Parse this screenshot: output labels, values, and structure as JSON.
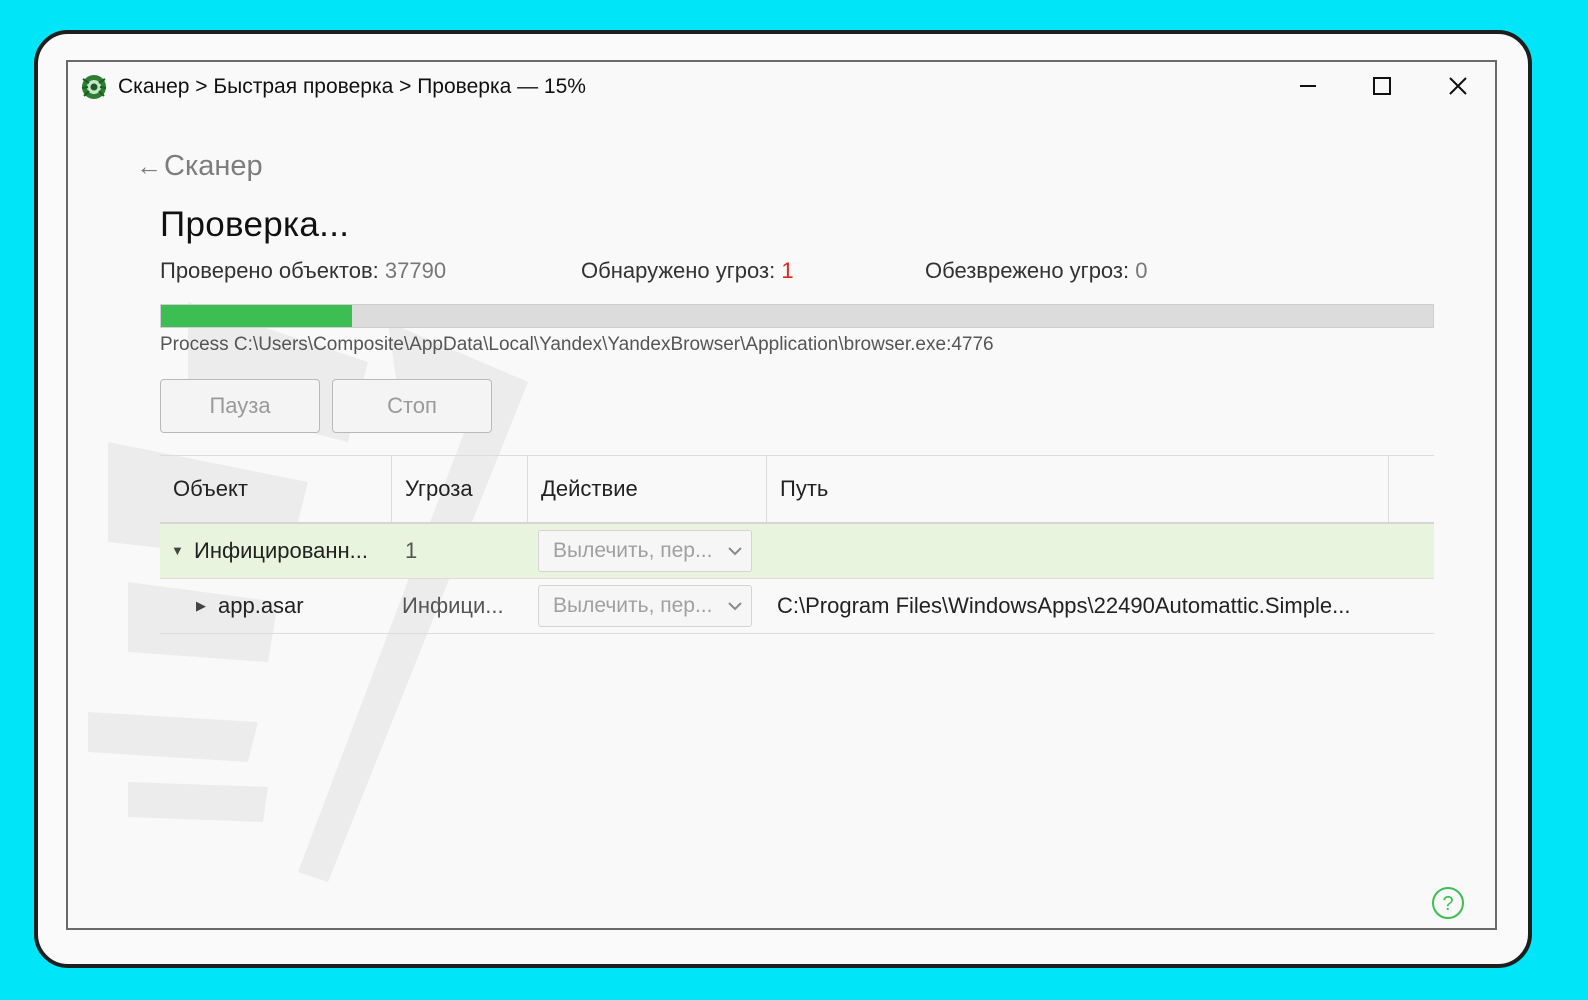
{
  "window": {
    "title": "Сканер > Быстрая проверка > Проверка — 15%"
  },
  "nav": {
    "back_label": "Сканер"
  },
  "scan": {
    "heading": "Проверка...",
    "stats": {
      "checked_label": "Проверено объектов: ",
      "checked_value": "37790",
      "found_label": "Обнаружено угроз: ",
      "found_value": "1",
      "neutralized_label": "Обезврежено угроз: ",
      "neutralized_value": "0"
    },
    "progress_percent": 15,
    "current_process": "Process C:\\Users\\Composite\\AppData\\Local\\Yandex\\YandexBrowser\\Application\\browser.exe:4776",
    "pause_label": "Пауза",
    "stop_label": "Стоп"
  },
  "table": {
    "columns": [
      "Объект",
      "Угроза",
      "Действие",
      "Путь"
    ],
    "rows": [
      {
        "object": "Инфицированн...",
        "threat": "1",
        "action": "Вылечить, пер...",
        "path": ""
      },
      {
        "object": "app.asar",
        "threat": "Инфици...",
        "action": "Вылечить, пер...",
        "path": "C:\\Program Files\\WindowsApps\\22490Automattic.Simple..."
      }
    ]
  },
  "colors": {
    "accent": "#3cbe52",
    "danger": "#e02424",
    "row_highlight": "#e8f4dd",
    "background": "#00e5f7"
  },
  "icons": {
    "app": "spider-logo-icon",
    "back": "arrow-left-icon",
    "minimize": "minimize-icon",
    "maximize": "maximize-icon",
    "close": "close-icon",
    "expand": "triangle-down-icon",
    "collapsed": "triangle-right-icon",
    "dropdown": "chevron-down-icon",
    "help": "help-icon"
  }
}
